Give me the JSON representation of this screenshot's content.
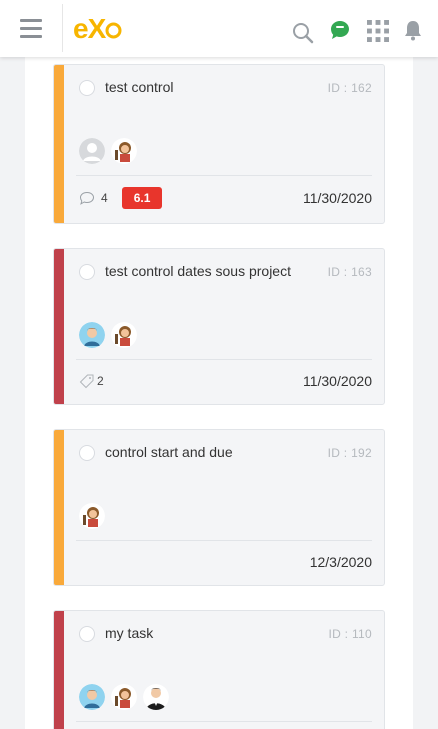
{
  "header": {
    "logo": {
      "e": "e",
      "x": "X",
      "o": "o"
    },
    "icons": [
      "hamburger-menu-icon",
      "search-icon",
      "chat-icon",
      "apps-grid-icon",
      "bell-icon"
    ],
    "colors": {
      "accent": "#f7b500",
      "chat": "#33a852"
    }
  },
  "tasks": [
    {
      "title": "test control",
      "id": "ID : 162",
      "status_color": "#f9a93a",
      "avatars": [
        "default-avatar",
        "user-avatar-cartoon"
      ],
      "comments": "4",
      "badge": "6.1",
      "date": "11/30/2020"
    },
    {
      "title": "test control dates sous project",
      "id": "ID : 163",
      "status_color": "#c0414b",
      "avatars": [
        "user-avatar-blue",
        "user-avatar-cartoon"
      ],
      "labels": "2",
      "date": "11/30/2020"
    },
    {
      "title": "control start and due",
      "id": "ID : 192",
      "status_color": "#f9a93a",
      "avatars": [
        "user-avatar-cartoon"
      ],
      "date": "12/3/2020"
    },
    {
      "title": "my task",
      "id": "ID : 110",
      "status_color": "#c0414b",
      "avatars": [
        "user-avatar-blue",
        "user-avatar-cartoon",
        "user-avatar-suit"
      ]
    }
  ]
}
